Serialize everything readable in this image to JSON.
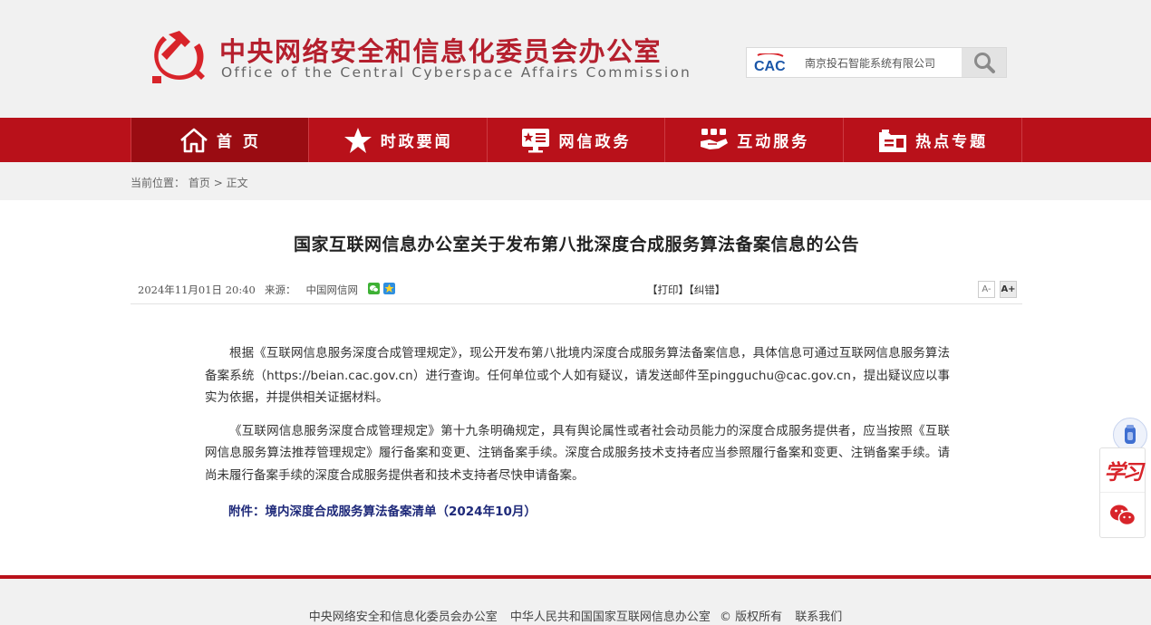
{
  "header": {
    "logo_cn": "中央网络安全和信息化委员会办公室",
    "logo_en": "Office of the Central Cyberspace Affairs Commission",
    "search": {
      "badge_text": "CAC",
      "value": "南京投石智能系统有限公司"
    }
  },
  "nav": {
    "items": [
      {
        "label": "首 页",
        "icon": "home-icon"
      },
      {
        "label": "时政要闻",
        "icon": "star-icon"
      },
      {
        "label": "网信政务",
        "icon": "monitor-icon"
      },
      {
        "label": "互动服务",
        "icon": "handshake-icon"
      },
      {
        "label": "热点专题",
        "icon": "folder-icon"
      }
    ]
  },
  "breadcrumb": {
    "prefix": "当前位置：",
    "home": "首页",
    "separator": ">",
    "current": "正文"
  },
  "article": {
    "title": "国家互联网信息办公室关于发布第八批深度合成服务算法备案信息的公告",
    "date": "2024年11月01日 20:40",
    "source_label": "来源：",
    "source": "中国网信网",
    "print": "【打印】",
    "correct": "【纠错】",
    "font_smaller": "A-",
    "font_larger": "A+",
    "paragraphs": [
      "根据《互联网信息服务深度合成管理规定》，现公开发布第八批境内深度合成服务算法备案信息，具体信息可通过互联网信息服务算法备案系统（https://beian.cac.gov.cn）进行查询。任何单位或个人如有疑议，请发送邮件至pingguchu@cac.gov.cn，提出疑议应以事实为依据，并提供相关证据材料。",
      "《互联网信息服务深度合成管理规定》第十九条明确规定，具有舆论属性或者社会动员能力的深度合成服务提供者，应当按照《互联网信息服务算法推荐管理规定》履行备案和变更、注销备案手续。深度合成服务技术支持者应当参照履行备案和变更、注销备案手续。请尚未履行备案手续的深度合成服务提供者和技术支持者尽快申请备案。"
    ],
    "attachment": "附件：境内深度合成服务算法备案清单（2024年10月）"
  },
  "footer": {
    "org1": "中央网络安全和信息化委员会办公室",
    "org2": "中华人民共和国国家互联网信息办公室",
    "copyright": "© 版权所有",
    "contact": "联系我们"
  },
  "float": {
    "xuexi": "学习"
  },
  "colors": {
    "brand_red": "#b9111a",
    "logo_red": "#b5202e",
    "attachment_blue": "#1f2a7a"
  }
}
